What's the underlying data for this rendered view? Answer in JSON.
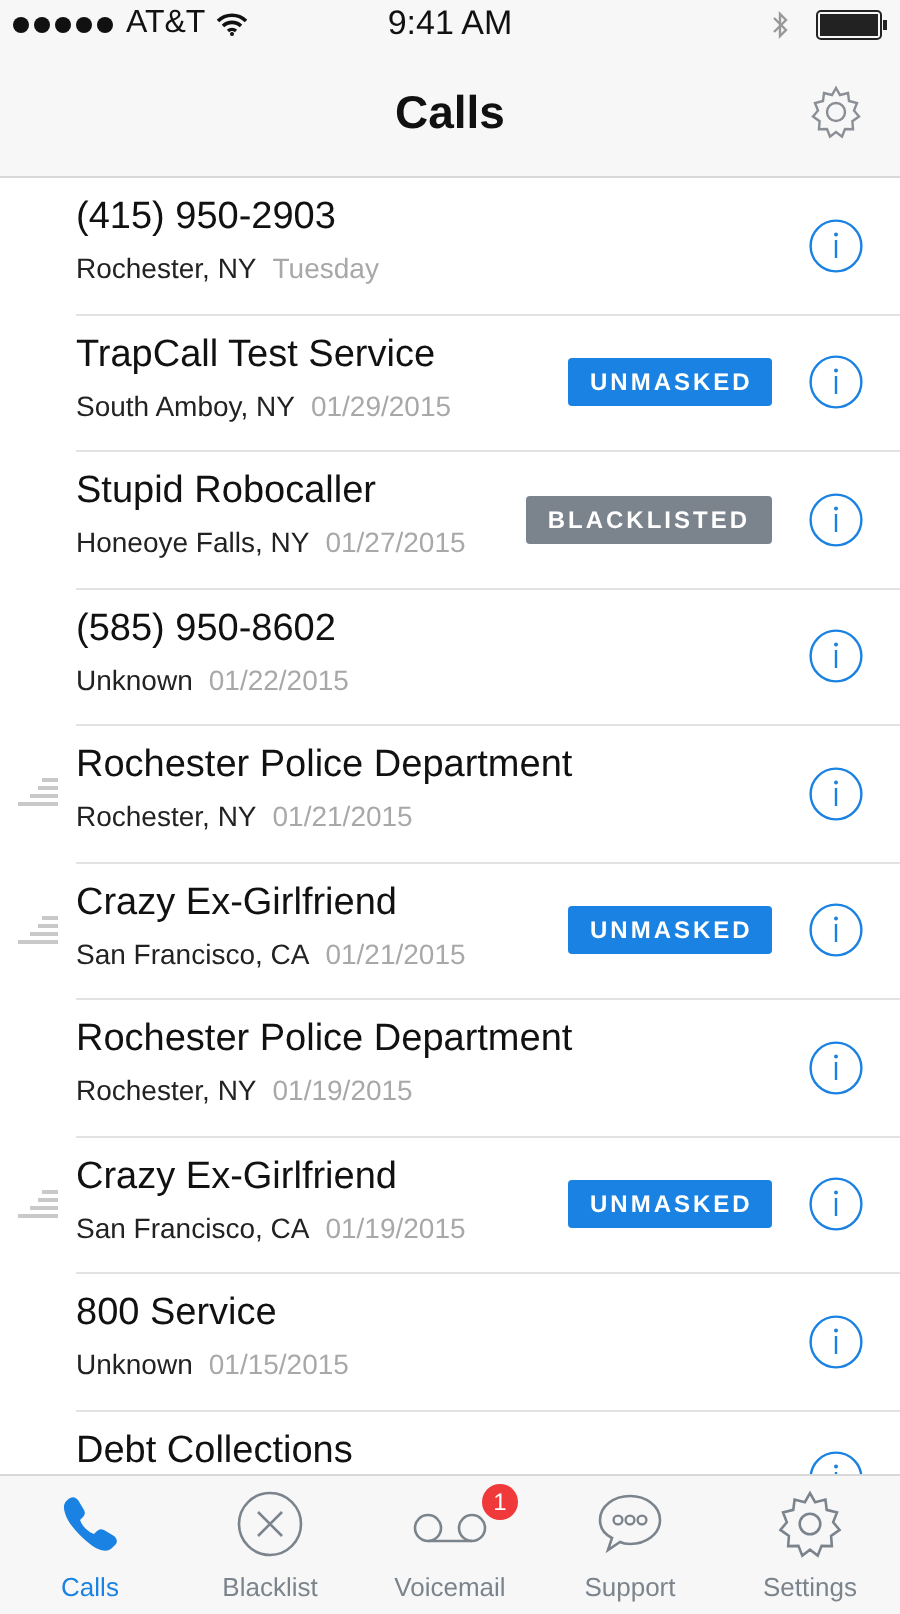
{
  "status_bar": {
    "carrier": "AT&T",
    "time": "9:41 AM"
  },
  "nav": {
    "title": "Calls"
  },
  "calls": [
    {
      "name": "(415) 950-2903",
      "location": "Rochester, NY",
      "date": "Tuesday",
      "recording": false
    },
    {
      "name": "TrapCall Test Service",
      "location": "South Amboy, NY",
      "date": "01/29/2015",
      "recording": false,
      "badge": {
        "kind": "unmasked",
        "label": "UNMASKED"
      }
    },
    {
      "name": "Stupid Robocaller",
      "location": "Honeoye Falls, NY",
      "date": "01/27/2015",
      "recording": false,
      "badge": {
        "kind": "blacklisted",
        "label": "BLACKLISTED"
      }
    },
    {
      "name": "(585) 950-8602",
      "location": "Unknown",
      "date": "01/22/2015",
      "recording": false
    },
    {
      "name": "Rochester Police Department",
      "location": "Rochester, NY",
      "date": "01/21/2015",
      "recording": true
    },
    {
      "name": "Crazy Ex-Girlfriend",
      "location": "San Francisco, CA",
      "date": "01/21/2015",
      "recording": true,
      "badge": {
        "kind": "unmasked",
        "label": "UNMASKED"
      }
    },
    {
      "name": "Rochester Police Department",
      "location": "Rochester, NY",
      "date": "01/19/2015",
      "recording": false
    },
    {
      "name": "Crazy Ex-Girlfriend",
      "location": "San Francisco, CA",
      "date": "01/19/2015",
      "recording": true,
      "badge": {
        "kind": "unmasked",
        "label": "UNMASKED"
      }
    },
    {
      "name": "800 Service",
      "location": "Unknown",
      "date": "01/15/2015",
      "recording": false
    },
    {
      "name": "Debt Collections",
      "recording": false
    }
  ],
  "tabs": [
    {
      "kind": "calls",
      "label": "Calls",
      "selected": true
    },
    {
      "kind": "blacklist",
      "label": "Blacklist",
      "selected": false
    },
    {
      "kind": "voicemail",
      "label": "Voicemail",
      "selected": false,
      "badge": "1"
    },
    {
      "kind": "support",
      "label": "Support",
      "selected": false
    },
    {
      "kind": "settings",
      "label": "Settings",
      "selected": false
    }
  ]
}
